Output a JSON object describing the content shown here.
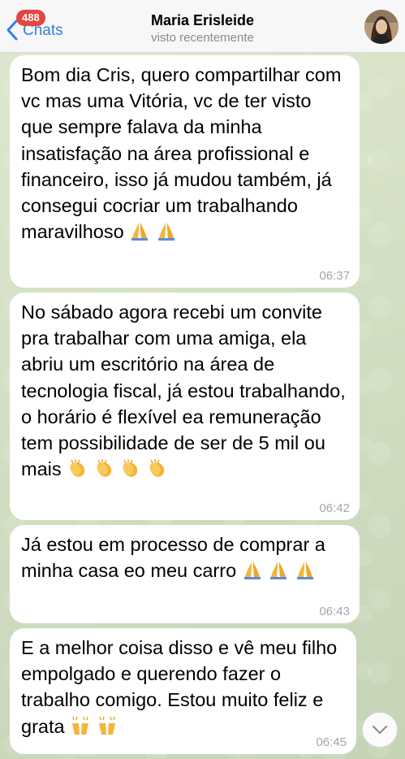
{
  "header": {
    "back_label": "Chats",
    "unread_count": "488",
    "contact_name": "Maria Erisleide",
    "status": "visto recentemente"
  },
  "messages": [
    {
      "text": "Bom dia Cris, quero compartilhar com vc mas uma Vitória, vc de ter visto que sempre falava da minha insatisfação na área profissional e financeiro, isso já mudou também, já consegui cocriar um trabalhando maravilhoso",
      "emojis": [
        "praying-hands",
        "praying-hands"
      ],
      "time": "06:37"
    },
    {
      "text": "No sábado agora recebi um convite pra trabalhar com uma amiga, ela abriu um escritório na área de tecnologia fiscal, já estou trabalhando, o horário é flexível ea remuneração tem possibilidade de ser de 5 mil ou mais",
      "emojis": [
        "clapping-hands",
        "clapping-hands",
        "clapping-hands",
        "clapping-hands"
      ],
      "time": "06:42"
    },
    {
      "text": "Já estou em processo de comprar a minha casa eo meu carro",
      "emojis": [
        "praying-hands",
        "praying-hands",
        "praying-hands"
      ],
      "time": "06:43"
    },
    {
      "text": "E a melhor coisa disso e vê meu filho empolgado e querendo fazer o trabalho comigo. Estou muito feliz e grata",
      "emojis": [
        "raising-hands",
        "raising-hands"
      ],
      "time": "06:45"
    }
  ],
  "colors": {
    "accent": "#2f7fe6",
    "badge": "#e2463f",
    "bubble": "#ffffff",
    "timestamp": "#a2a6a9"
  }
}
